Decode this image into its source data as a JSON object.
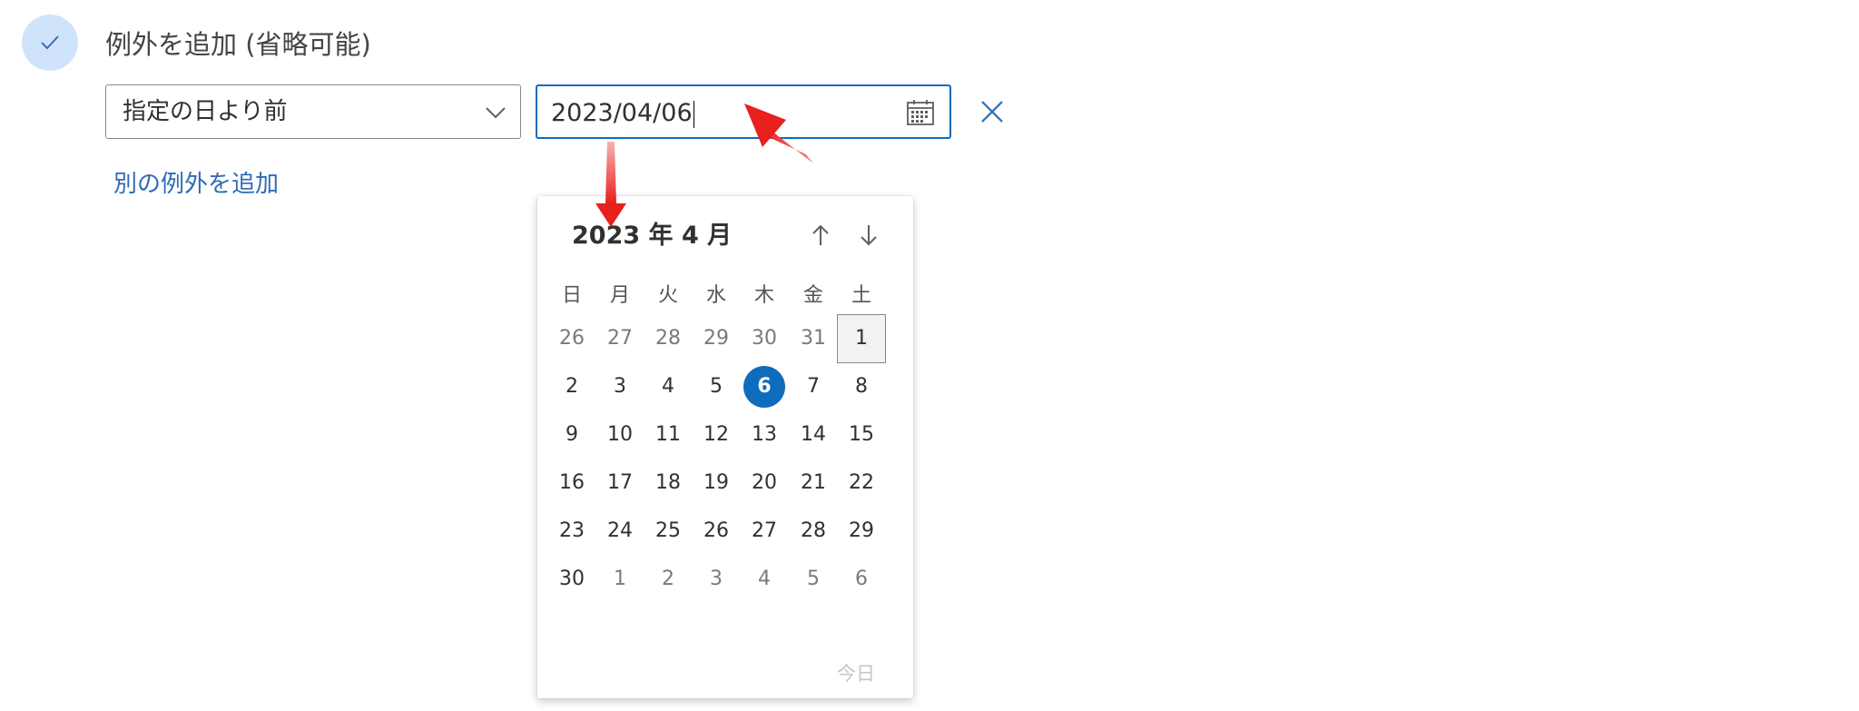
{
  "section": {
    "title": "例外を追加 (省略可能)"
  },
  "condition_dropdown": {
    "value": "指定の日より前"
  },
  "date_input": {
    "value": "2023/04/06"
  },
  "add_exception_link": "別の例外を追加",
  "calendar": {
    "month_label": "2023 年 4 月",
    "weekdays": [
      "日",
      "月",
      "火",
      "水",
      "木",
      "金",
      "土"
    ],
    "weeks": [
      [
        "26",
        "27",
        "28",
        "29",
        "30",
        "31",
        "1"
      ],
      [
        "2",
        "3",
        "4",
        "5",
        "6",
        "7",
        "8"
      ],
      [
        "9",
        "10",
        "11",
        "12",
        "13",
        "14",
        "15"
      ],
      [
        "16",
        "17",
        "18",
        "19",
        "20",
        "21",
        "22"
      ],
      [
        "23",
        "24",
        "25",
        "26",
        "27",
        "28",
        "29"
      ],
      [
        "30",
        "1",
        "2",
        "3",
        "4",
        "5",
        "6"
      ]
    ],
    "selected_day": "6",
    "focused_day": "1",
    "today_label": "今日"
  },
  "colors": {
    "accent": "#0f6cbd",
    "link": "#2e6ab7",
    "annotation_arrow": "#e8201e"
  }
}
